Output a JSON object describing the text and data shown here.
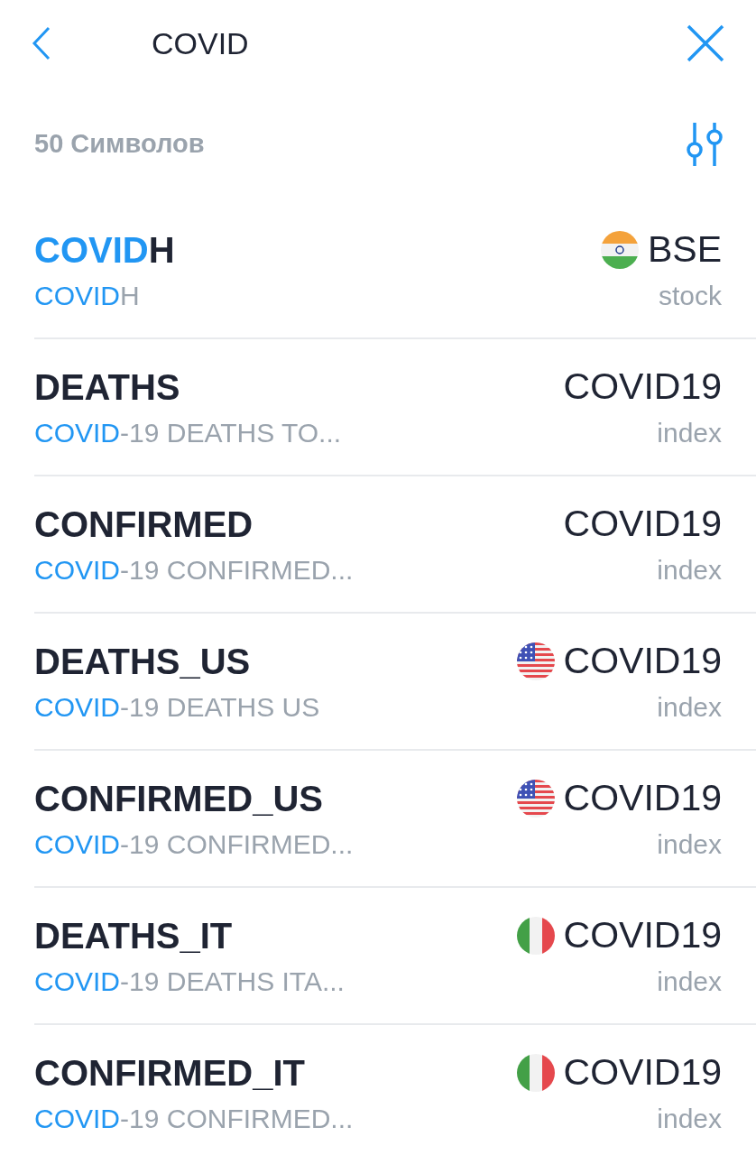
{
  "header": {
    "query": "COVID"
  },
  "results_count": "50 Символов",
  "rows": [
    {
      "symbol_match": "COVID",
      "symbol_rest": "H",
      "kind": "india",
      "exchange": "BSE",
      "description_match": "COVID",
      "description_rest": "H",
      "type": "stock"
    },
    {
      "symbol_match": "",
      "symbol_rest": "DEATHS",
      "kind": "plain",
      "exchange": "COVID19",
      "description_match": "COVID",
      "description_rest": "-19 DEATHS TO...",
      "type": "index"
    },
    {
      "symbol_match": "",
      "symbol_rest": "CONFIRMED",
      "kind": "plain",
      "exchange": "COVID19",
      "description_match": "COVID",
      "description_rest": "-19 CONFIRMED...",
      "type": "index"
    },
    {
      "symbol_match": "",
      "symbol_rest": "DEATHS_US",
      "kind": "us",
      "exchange": "COVID19",
      "description_match": "COVID",
      "description_rest": "-19 DEATHS US",
      "type": "index"
    },
    {
      "symbol_match": "",
      "symbol_rest": "CONFIRMED_US",
      "kind": "us",
      "exchange": "COVID19",
      "description_match": "COVID",
      "description_rest": "-19 CONFIRMED...",
      "type": "index"
    },
    {
      "symbol_match": "",
      "symbol_rest": "DEATHS_IT",
      "kind": "italy",
      "exchange": "COVID19",
      "description_match": "COVID",
      "description_rest": "-19 DEATHS ITA...",
      "type": "index"
    },
    {
      "symbol_match": "",
      "symbol_rest": "CONFIRMED_IT",
      "kind": "italy",
      "exchange": "COVID19",
      "description_match": "COVID",
      "description_rest": "-19 CONFIRMED...",
      "type": "index"
    }
  ]
}
